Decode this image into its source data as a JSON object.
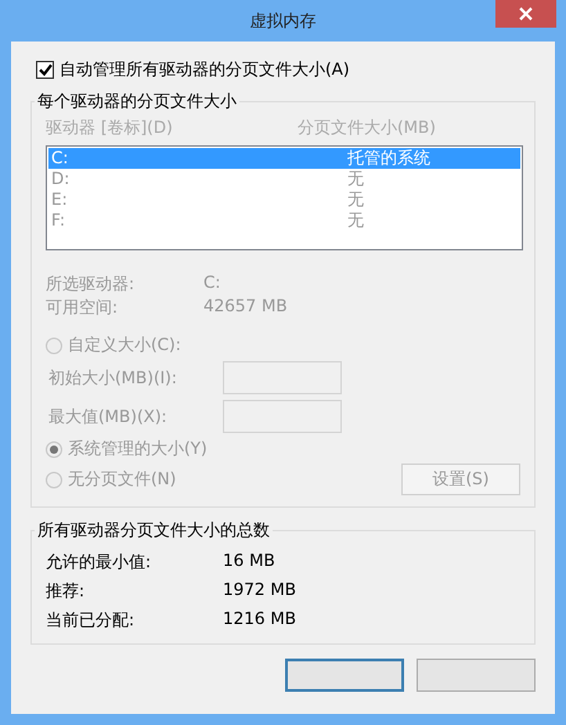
{
  "window": {
    "title": "虚拟内存"
  },
  "auto_manage": {
    "label": "自动管理所有驱动器的分页文件大小(A)",
    "checked": true
  },
  "per_drive": {
    "title": "每个驱动器的分页文件大小",
    "disabled": true,
    "columns": [
      "驱动器 [卷标](D)",
      "分页文件大小(MB)"
    ],
    "drives": [
      {
        "drive": "C:",
        "size": "托管的系统",
        "selected": true
      },
      {
        "drive": "D:",
        "size": "无",
        "selected": false
      },
      {
        "drive": "E:",
        "size": "无",
        "selected": false
      },
      {
        "drive": "F:",
        "size": "无",
        "selected": false
      }
    ],
    "info": [
      {
        "label": "所选驱动器:",
        "value": "C:"
      },
      {
        "label": "可用空间:",
        "value": "42657 MB"
      }
    ],
    "options": [
      {
        "kind": "radio",
        "label": "自定义大小(C):",
        "selected": false
      },
      {
        "kind": "field",
        "label": "初始大小(MB)(I):"
      },
      {
        "kind": "field",
        "label": "最大值(MB)(X):"
      },
      {
        "kind": "radio",
        "label": "系统管理的大小(Y)",
        "selected": true
      },
      {
        "kind": "radio",
        "label": "无分页文件(N)",
        "selected": false
      }
    ],
    "set_button": "设置(S)"
  },
  "totals": {
    "title": "所有驱动器分页文件大小的总数",
    "rows": [
      {
        "label": "允许的最小值:",
        "value": "16 MB"
      },
      {
        "label": "推荐:",
        "value": "1972 MB"
      },
      {
        "label": "当前已分配:",
        "value": "1216 MB"
      }
    ]
  },
  "dialog_buttons": [
    {
      "focused": true
    },
    {
      "focused": false
    }
  ]
}
